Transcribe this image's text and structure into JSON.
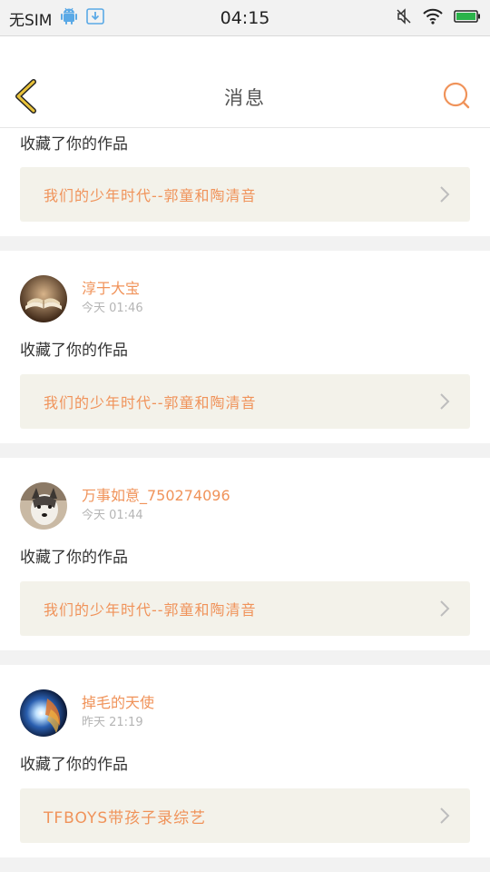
{
  "status_bar": {
    "carrier": "无SIM",
    "time": "04:15"
  },
  "header": {
    "title": "消息"
  },
  "colors": {
    "accent": "#f0935a",
    "back_arrow": "#e8c23a",
    "work_box_bg": "#f3f2ea",
    "divider": "#f2f2f2"
  },
  "messages": [
    {
      "action": "收藏了你的作品",
      "work_title": "我们的少年时代--郭童和陶清音"
    },
    {
      "user": "淳于大宝",
      "time": "今天 01:46",
      "avatar": "book-avatar",
      "action": "收藏了你的作品",
      "work_title": "我们的少年时代--郭童和陶清音"
    },
    {
      "user": "万事如意_750274096",
      "time": "今天 01:44",
      "avatar": "dog-avatar",
      "action": "收藏了你的作品",
      "work_title": "我们的少年时代--郭童和陶清音"
    },
    {
      "user": "掉毛的天使",
      "time": "昨天 21:19",
      "avatar": "nebula-avatar",
      "action": "收藏了你的作品",
      "work_title": "TFBOYS带孩子录综艺"
    }
  ]
}
